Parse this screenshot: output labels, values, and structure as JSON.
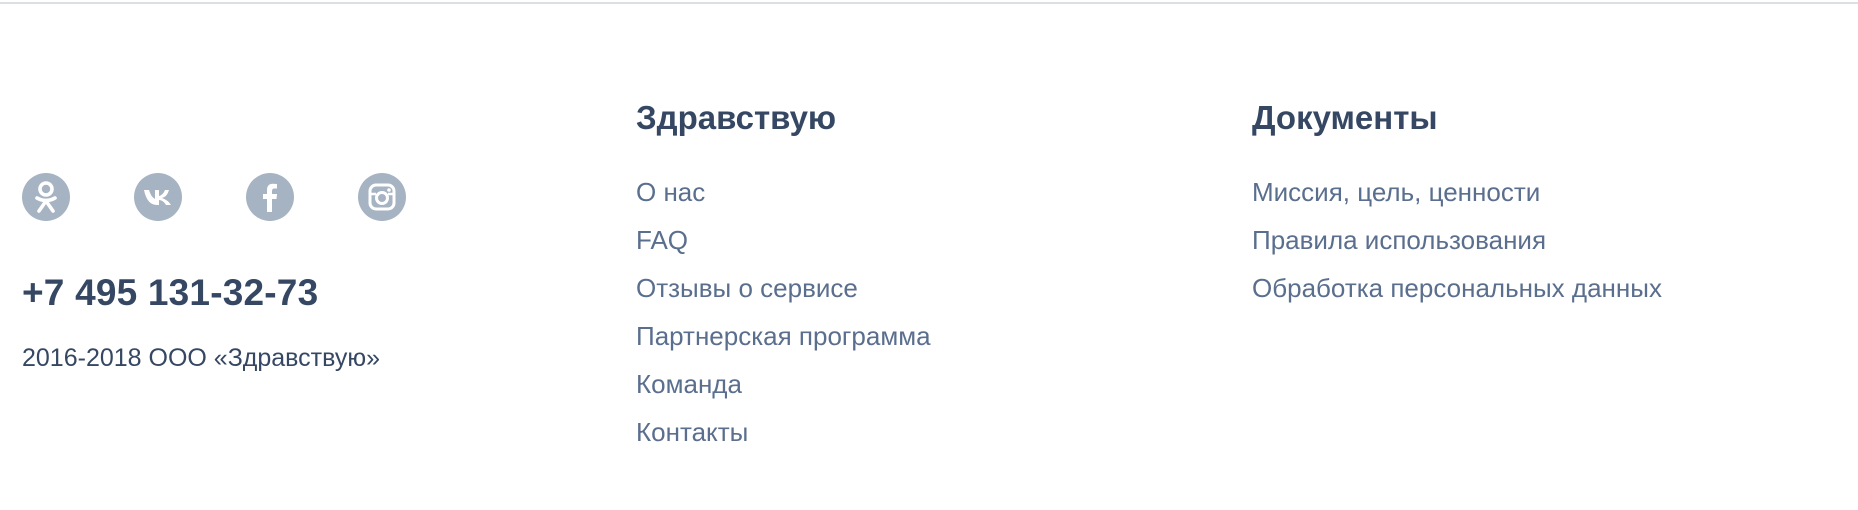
{
  "social": [
    {
      "name": "odnoklassniki",
      "icon": "odnoklassniki-icon"
    },
    {
      "name": "vkontakte",
      "icon": "vk-icon"
    },
    {
      "name": "facebook",
      "icon": "facebook-icon"
    },
    {
      "name": "instagram",
      "icon": "instagram-icon"
    }
  ],
  "contact": {
    "phone": "+7 495 131-32-73",
    "copyright": "2016-2018 ООО «Здравствую»"
  },
  "columns": [
    {
      "heading": "Здравствую",
      "links": [
        "О нас",
        "FAQ",
        "Отзывы о сервисе",
        "Партнерская программа",
        "Команда",
        "Контакты"
      ]
    },
    {
      "heading": "Документы",
      "links": [
        "Миссия, цель, ценности",
        "Правила использования",
        "Обработка персональных данных"
      ]
    }
  ],
  "colors": {
    "heading": "#354762",
    "link": "#5a6e8d",
    "social_bg": "#a6b3c3",
    "divider": "#dcdfe4"
  }
}
